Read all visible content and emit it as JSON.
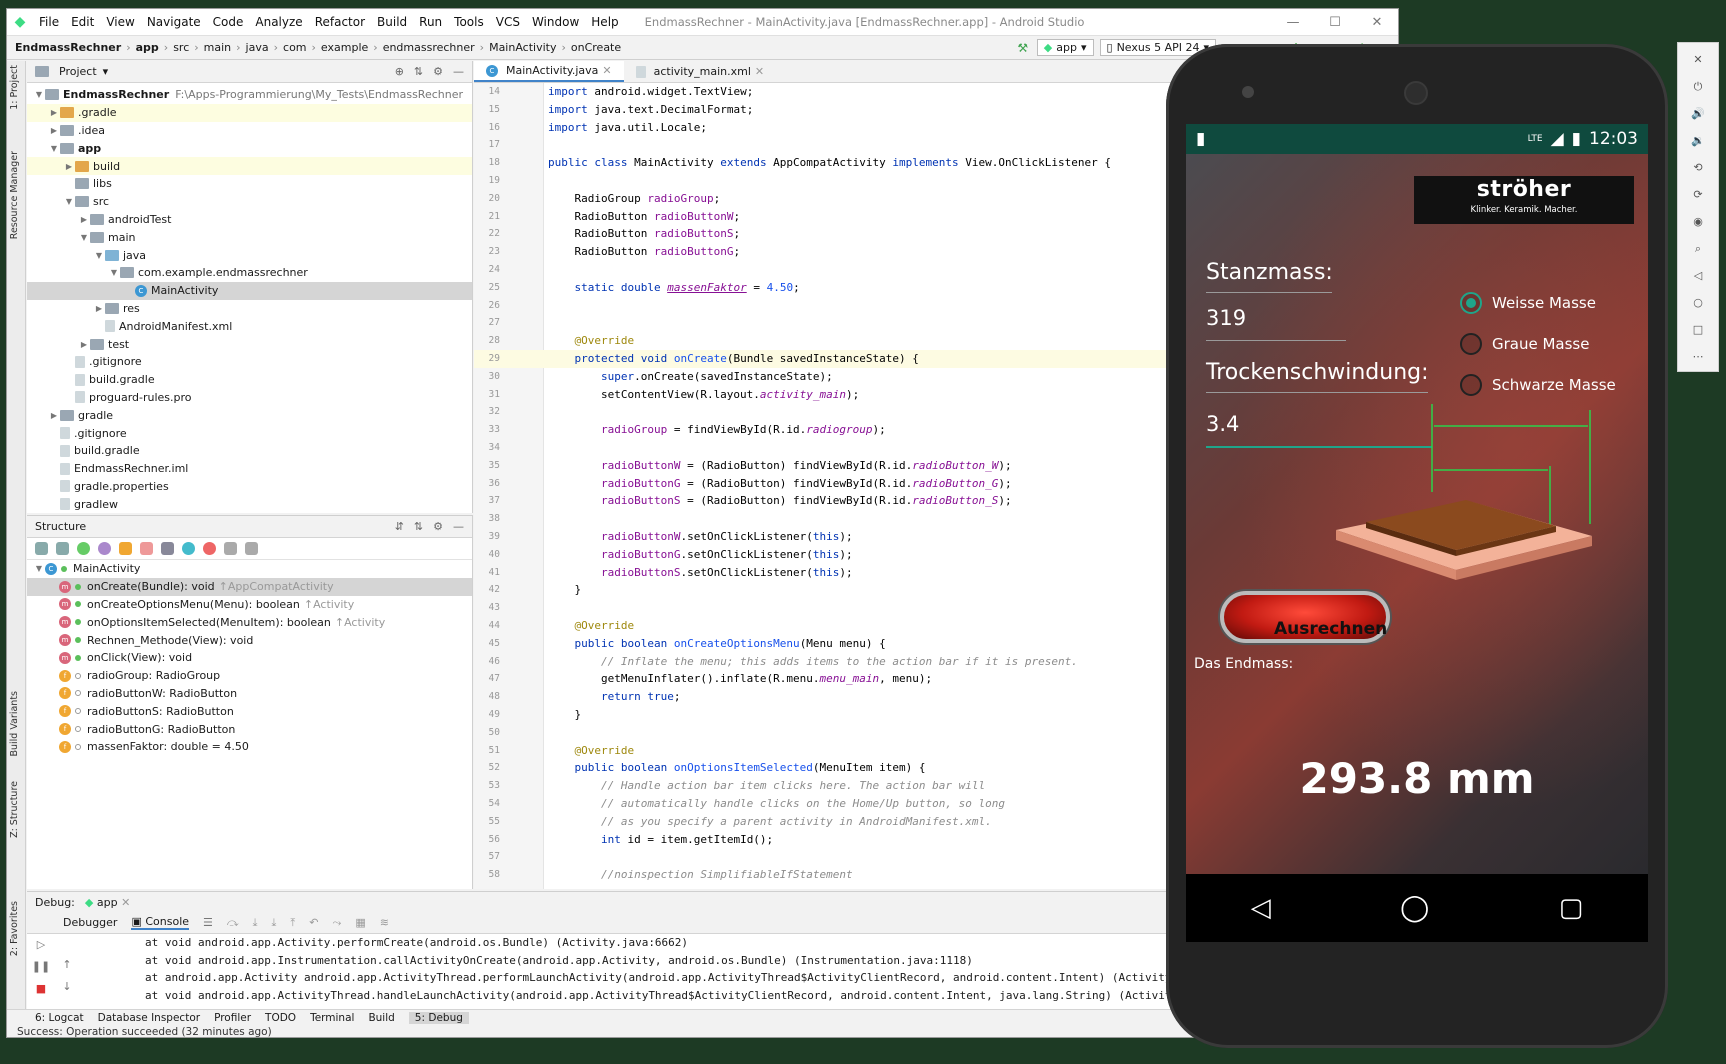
{
  "ide": {
    "menu": [
      "File",
      "Edit",
      "View",
      "Navigate",
      "Code",
      "Analyze",
      "Refactor",
      "Build",
      "Run",
      "Tools",
      "VCS",
      "Window",
      "Help"
    ],
    "window_title": "EndmassRechner - MainActivity.java [EndmassRechner.app] - Android Studio",
    "breadcrumb": [
      "EndmassRechner",
      "app",
      "src",
      "main",
      "java",
      "com",
      "example",
      "endmassrechner",
      "MainActivity",
      "onCreate"
    ],
    "run_config": "app",
    "device": "Nexus 5 API 24",
    "project_panel_title": "Project",
    "project_tree": [
      {
        "label": "EndmassRechner",
        "path": "F:\\Apps-Programmierung\\My_Tests\\EndmassRechner",
        "depth": 0,
        "arrow": "▼",
        "icon": "fold",
        "bold": true
      },
      {
        "label": ".gradle",
        "depth": 1,
        "arrow": "▶",
        "icon": "fold or",
        "style": "yel"
      },
      {
        "label": ".idea",
        "depth": 1,
        "arrow": "▶",
        "icon": "fold"
      },
      {
        "label": "app",
        "depth": 1,
        "arrow": "▼",
        "icon": "fold",
        "bold": true
      },
      {
        "label": "build",
        "depth": 2,
        "arrow": "▶",
        "icon": "fold or",
        "style": "yel"
      },
      {
        "label": "libs",
        "depth": 2,
        "arrow": "",
        "icon": "fold"
      },
      {
        "label": "src",
        "depth": 2,
        "arrow": "▼",
        "icon": "fold"
      },
      {
        "label": "androidTest",
        "depth": 3,
        "arrow": "▶",
        "icon": "fold"
      },
      {
        "label": "main",
        "depth": 3,
        "arrow": "▼",
        "icon": "fold"
      },
      {
        "label": "java",
        "depth": 4,
        "arrow": "▼",
        "icon": "fold bl"
      },
      {
        "label": "com.example.endmassrechner",
        "depth": 5,
        "arrow": "▼",
        "icon": "fold"
      },
      {
        "label": "MainActivity",
        "depth": 6,
        "arrow": "",
        "icon": "cls",
        "style": "sel"
      },
      {
        "label": "res",
        "depth": 4,
        "arrow": "▶",
        "icon": "fold"
      },
      {
        "label": "AndroidManifest.xml",
        "depth": 4,
        "arrow": "",
        "icon": "fil"
      },
      {
        "label": "test",
        "depth": 3,
        "arrow": "▶",
        "icon": "fold"
      },
      {
        "label": ".gitignore",
        "depth": 2,
        "arrow": "",
        "icon": "fil"
      },
      {
        "label": "build.gradle",
        "depth": 2,
        "arrow": "",
        "icon": "fil"
      },
      {
        "label": "proguard-rules.pro",
        "depth": 2,
        "arrow": "",
        "icon": "fil"
      },
      {
        "label": "gradle",
        "depth": 1,
        "arrow": "▶",
        "icon": "fold"
      },
      {
        "label": ".gitignore",
        "depth": 1,
        "arrow": "",
        "icon": "fil"
      },
      {
        "label": "build.gradle",
        "depth": 1,
        "arrow": "",
        "icon": "fil"
      },
      {
        "label": "EndmassRechner.iml",
        "depth": 1,
        "arrow": "",
        "icon": "fil"
      },
      {
        "label": "gradle.properties",
        "depth": 1,
        "arrow": "",
        "icon": "fil"
      },
      {
        "label": "gradlew",
        "depth": 1,
        "arrow": "",
        "icon": "fil"
      }
    ],
    "structure_title": "Structure",
    "structure_root": "MainActivity",
    "structure_items": [
      {
        "kind": "m",
        "name": "onCreate(Bundle): void",
        "inh": "↑AppCompatActivity",
        "vis": "on",
        "sel": true
      },
      {
        "kind": "m",
        "name": "onCreateOptionsMenu(Menu): boolean",
        "inh": "↑Activity",
        "vis": "on"
      },
      {
        "kind": "m",
        "name": "onOptionsItemSelected(MenuItem): boolean",
        "inh": "↑Activity",
        "vis": "on"
      },
      {
        "kind": "m",
        "name": "Rechnen_Methode(View): void",
        "inh": "",
        "vis": "on"
      },
      {
        "kind": "m",
        "name": "onClick(View): void",
        "inh": "",
        "vis": "on"
      },
      {
        "kind": "f",
        "name": "radioGroup: RadioGroup",
        "inh": "",
        "vis": "o"
      },
      {
        "kind": "f",
        "name": "radioButtonW: RadioButton",
        "inh": "",
        "vis": "o"
      },
      {
        "kind": "f",
        "name": "radioButtonS: RadioButton",
        "inh": "",
        "vis": "o"
      },
      {
        "kind": "f",
        "name": "radioButtonG: RadioButton",
        "inh": "",
        "vis": "o"
      },
      {
        "kind": "f",
        "name": "massenFaktor: double = 4.50",
        "inh": "",
        "vis": "o"
      }
    ],
    "editor_tabs": [
      "MainActivity.java",
      "activity_main.xml"
    ],
    "code_lines": [
      {
        "n": "14",
        "html": "<span class='kw'>import</span> android.widget.TextView;"
      },
      {
        "n": "15",
        "html": "<span class='kw'>import</span> java.text.DecimalFormat;"
      },
      {
        "n": "16",
        "html": "<span class='kw'>import</span> java.util.Locale;"
      },
      {
        "n": "17",
        "html": ""
      },
      {
        "n": "18",
        "html": "<span class='kw'>public class</span> MainActivity <span class='kw'>extends</span> AppCompatActivity <span class='kw'>implements</span> View.OnClickListener {"
      },
      {
        "n": "19",
        "html": ""
      },
      {
        "n": "20",
        "html": "    RadioGroup <span class='fld'>radioGroup</span>;"
      },
      {
        "n": "21",
        "html": "    RadioButton <span class='fld'>radioButtonW</span>;"
      },
      {
        "n": "22",
        "html": "    RadioButton <span class='fld'>radioButtonS</span>;"
      },
      {
        "n": "23",
        "html": "    RadioButton <span class='fld'>radioButtonG</span>;"
      },
      {
        "n": "24",
        "html": ""
      },
      {
        "n": "25",
        "html": "    <span class='kw'>static double</span> <span class='fld'><i><u>massenFaktor</u></i></span> = <span class='nm'>4.50</span>;"
      },
      {
        "n": "26",
        "html": ""
      },
      {
        "n": "27",
        "html": ""
      },
      {
        "n": "28",
        "html": "    <span class='an'>@Override</span>"
      },
      {
        "n": "29",
        "html": "    <span class='kw'>protected void</span> <span class='nm'>onCreate</span>(Bundle savedInstanceState) {",
        "hl": true
      },
      {
        "n": "30",
        "html": "        <span class='kw'>super</span>.onCreate(savedInstanceState);"
      },
      {
        "n": "31",
        "html": "        setContentView(R.layout.<span class='fld'><i>activity_main</i></span>);"
      },
      {
        "n": "32",
        "html": ""
      },
      {
        "n": "33",
        "html": "        <span class='fld'>radioGroup</span> = findViewById(R.id.<span class='fld'><i>radiogroup</i></span>);"
      },
      {
        "n": "34",
        "html": ""
      },
      {
        "n": "35",
        "html": "        <span class='fld'>radioButtonW</span> = (RadioButton) findViewById(R.id.<span class='fld'><i>radioButton_W</i></span>);"
      },
      {
        "n": "36",
        "html": "        <span class='fld'>radioButtonG</span> = (RadioButton) findViewById(R.id.<span class='fld'><i>radioButton_G</i></span>);"
      },
      {
        "n": "37",
        "html": "        <span class='fld'>radioButtonS</span> = (RadioButton) findViewById(R.id.<span class='fld'><i>radioButton_S</i></span>);"
      },
      {
        "n": "38",
        "html": ""
      },
      {
        "n": "39",
        "html": "        <span class='fld'>radioButtonW</span>.setOnClickListener(<span class='kw'>this</span>);"
      },
      {
        "n": "40",
        "html": "        <span class='fld'>radioButtonG</span>.setOnClickListener(<span class='kw'>this</span>);"
      },
      {
        "n": "41",
        "html": "        <span class='fld'>radioButtonS</span>.setOnClickListener(<span class='kw'>this</span>);"
      },
      {
        "n": "42",
        "html": "    }"
      },
      {
        "n": "43",
        "html": ""
      },
      {
        "n": "44",
        "html": "    <span class='an'>@Override</span>"
      },
      {
        "n": "45",
        "html": "    <span class='kw'>public boolean</span> <span class='nm'>onCreateOptionsMenu</span>(Menu menu) {"
      },
      {
        "n": "46",
        "html": "        <span class='cm'>// Inflate the menu; this adds items to the action bar if it is present.</span>"
      },
      {
        "n": "47",
        "html": "        getMenuInflater().inflate(R.menu.<span class='fld'><i>menu_main</i></span>, menu);"
      },
      {
        "n": "48",
        "html": "        <span class='kw'>return true</span>;"
      },
      {
        "n": "49",
        "html": "    }"
      },
      {
        "n": "50",
        "html": ""
      },
      {
        "n": "51",
        "html": "    <span class='an'>@Override</span>"
      },
      {
        "n": "52",
        "html": "    <span class='kw'>public boolean</span> <span class='nm'>onOptionsItemSelected</span>(MenuItem item) {"
      },
      {
        "n": "53",
        "html": "        <span class='cm'>// Handle action bar item clicks here. The action bar will</span>"
      },
      {
        "n": "54",
        "html": "        <span class='cm'>// automatically handle clicks on the Home/Up button, so long</span>"
      },
      {
        "n": "55",
        "html": "        <span class='cm'>// as you specify a parent activity in AndroidManifest.xml.</span>"
      },
      {
        "n": "56",
        "html": "        <span class='kw'>int</span> id = item.getItemId();"
      },
      {
        "n": "57",
        "html": ""
      },
      {
        "n": "58",
        "html": "        <span class='cm'>//noinspection SimplifiableIfStatement</span>"
      }
    ],
    "debug_label": "Debug:",
    "debug_config": "app",
    "debug_tabs": [
      "Debugger",
      "Console"
    ],
    "console_lines": [
      "at void android.app.Activity.performCreate(android.os.Bundle) (Activity.java:6662)",
      "at void android.app.Instrumentation.callActivityOnCreate(android.app.Activity, android.os.Bundle) (Instrumentation.java:1118)",
      "at android.app.Activity android.app.ActivityThread.performLaunchActivity(android.app.ActivityThread$ActivityClientRecord, android.content.Intent) (ActivityThr",
      "at void android.app.ActivityThread.handleLaunchActivity(android.app.ActivityThread$ActivityClientRecord, android.content.Intent, java.lang.String) (ActivityTh"
    ],
    "bottom_tabs": [
      "6: Logcat",
      "Database Inspector",
      "Profiler",
      "TODO",
      "Terminal",
      "Build",
      "5: Debug"
    ],
    "status": "Success: Operation succeeded (32 minutes ago)",
    "left_strip": [
      "1: Project",
      "Resource Manager",
      "Build Variants",
      "Z: Structure",
      "2: Favorites"
    ]
  },
  "phone": {
    "network": "LTE",
    "time": "12:03",
    "brand": "ströher",
    "tagline": "Klinker. Keramik. Macher.",
    "stanzmass_label": "Stanzmass:",
    "stanzmass_value": "319",
    "trocken_label": "Trockenschwindung:",
    "trocken_value": "3.4",
    "radios": [
      "Weisse Masse",
      "Graue Masse",
      "Schwarze Masse"
    ],
    "button": "Ausrechnen",
    "result_label": "Das Endmass:",
    "result": "293.8 mm"
  }
}
